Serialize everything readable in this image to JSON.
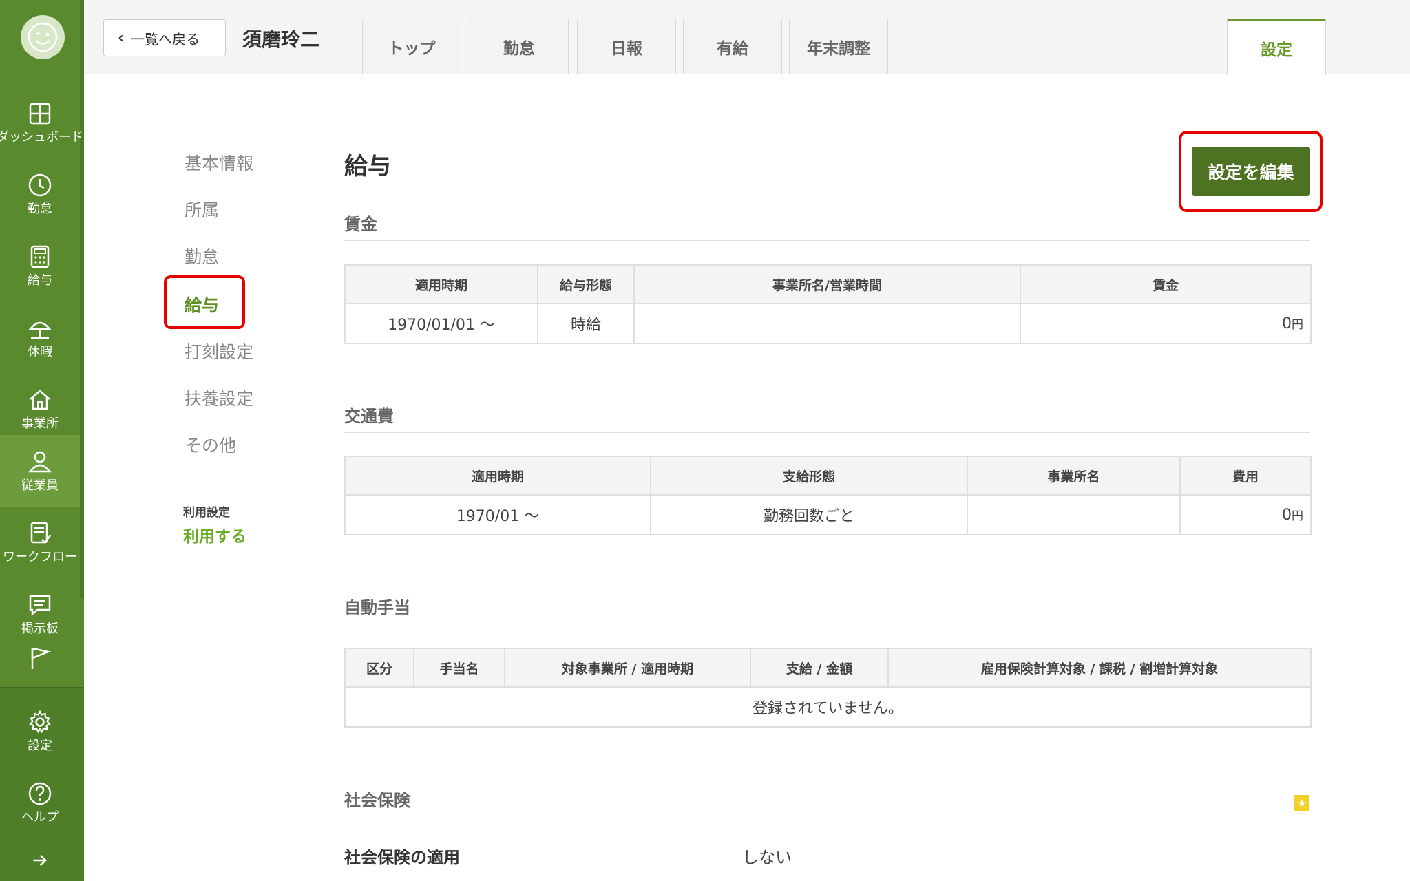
{
  "colors": {
    "brand_green": "#5a8a2e",
    "accent_green": "#6a9a2d",
    "edit_button": "#4d7222",
    "highlight_red": "#e60000"
  },
  "sidebar": {
    "items": [
      {
        "icon": "dashboard-icon",
        "label": "ダッシュボード"
      },
      {
        "icon": "clock-icon",
        "label": "勤怠"
      },
      {
        "icon": "calculator-icon",
        "label": "給与"
      },
      {
        "icon": "umbrella-icon",
        "label": "休暇"
      },
      {
        "icon": "home-icon",
        "label": "事業所"
      },
      {
        "icon": "person-icon",
        "label": "従業員"
      },
      {
        "icon": "checklist-icon",
        "label": "ワークフロー"
      },
      {
        "icon": "chat-icon",
        "label": "掲示板"
      },
      {
        "icon": "flag-icon",
        "label": ""
      },
      {
        "icon": "gear-icon",
        "label": "設定"
      },
      {
        "icon": "help-icon",
        "label": "ヘルプ"
      },
      {
        "icon": "arrow-right-icon",
        "label": ""
      }
    ]
  },
  "header": {
    "back_label": "一覧へ戻る",
    "employee_name": "須磨玲二",
    "tabs": [
      "トップ",
      "勤怠",
      "日報",
      "有給",
      "年末調整"
    ],
    "settings_tab": "設定"
  },
  "leftmenu": {
    "items": [
      "基本情報",
      "所属",
      "勤怠",
      "給与",
      "打刻設定",
      "扶養設定",
      "その他"
    ],
    "active": "給与",
    "usage_label": "利用設定",
    "usage_value": "利用する"
  },
  "main": {
    "title": "給与",
    "edit_button": "設定を編集",
    "wage": {
      "title": "賃金",
      "headers": [
        "適用時期",
        "給与形態",
        "事業所名/営業時間",
        "賃金"
      ],
      "row": {
        "period": "1970/01/01 〜",
        "type": "時給",
        "office": "",
        "amount": "0",
        "unit": "円"
      }
    },
    "transport": {
      "title": "交通費",
      "headers": [
        "適用時期",
        "支給形態",
        "事業所名",
        "費用"
      ],
      "row": {
        "period": "1970/01 〜",
        "type": "勤務回数ごと",
        "office": "",
        "amount": "0",
        "unit": "円"
      }
    },
    "allowance": {
      "title": "自動手当",
      "headers": [
        "区分",
        "手当名",
        "対象事業所 / 適用時期",
        "支給 / 金額",
        "雇用保険計算対象 / 課税 / 割増計算対象"
      ],
      "empty": "登録されていません。"
    },
    "social_insurance": {
      "title": "社会保険",
      "label": "社会保険の適用",
      "value": "しない"
    }
  }
}
